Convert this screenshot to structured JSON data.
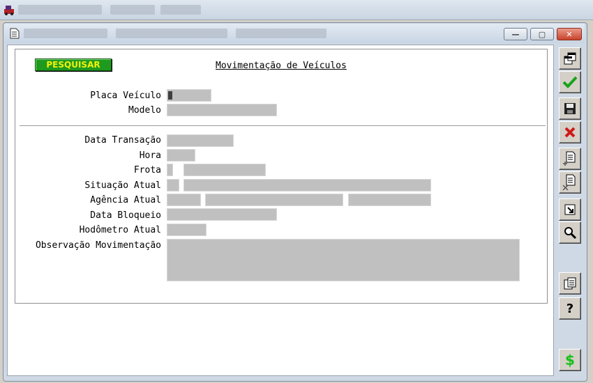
{
  "window": {
    "minimize_glyph": "—",
    "maximize_glyph": "▢",
    "close_glyph": "✕"
  },
  "form": {
    "search_button_label": "PESQUISAR",
    "title": "Movimentação de Veículos",
    "labels": {
      "placa_veiculo": "Placa Veículo",
      "modelo": "Modelo",
      "data_transacao": "Data Transação",
      "hora": "Hora",
      "frota": "Frota",
      "situacao_atual": "Situação Atual",
      "agencia_atual": "Agência Atual",
      "data_bloqueio": "Data Bloqueio",
      "hodometro_atual": "Hodômetro Atual",
      "observacao_movimentacao": "Observação Movimentação"
    }
  },
  "toolbar": {
    "icons": [
      "restore-windows-icon",
      "confirm-check-icon",
      "save-disk-icon",
      "cancel-x-icon",
      "new-record-icon",
      "delete-record-icon",
      "go-to-icon",
      "search-magnifier-icon",
      "copy-pages-icon",
      "help-question-icon",
      "currency-dollar-icon"
    ],
    "help_glyph": "?",
    "dollar_glyph": "$",
    "colors": {
      "check": "#1aa31a",
      "cancel": "#d01818",
      "dollar": "#18c018"
    }
  }
}
